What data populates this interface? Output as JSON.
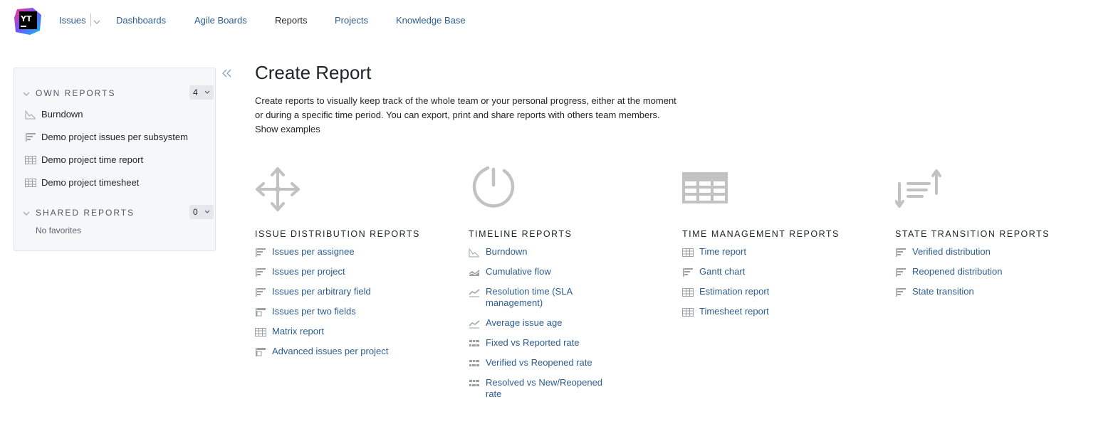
{
  "nav": {
    "logo_text": "YT",
    "items": [
      {
        "label": "Issues"
      },
      {
        "label": "Dashboards"
      },
      {
        "label": "Agile Boards"
      },
      {
        "label": "Reports"
      },
      {
        "label": "Projects"
      },
      {
        "label": "Knowledge Base"
      }
    ]
  },
  "sidebar": {
    "own": {
      "title": "OWN REPORTS",
      "count": "4",
      "items": [
        {
          "label": "Burndown",
          "icon": "burndown-icon"
        },
        {
          "label": "Demo project issues per subsystem",
          "icon": "distribution-icon"
        },
        {
          "label": "Demo project time report",
          "icon": "table-icon"
        },
        {
          "label": "Demo project timesheet",
          "icon": "table-icon"
        }
      ]
    },
    "shared": {
      "title": "SHARED REPORTS",
      "count": "0",
      "empty_text": "No favorites"
    }
  },
  "main": {
    "title": "Create Report",
    "intro": "Create reports to visually keep track of the whole team or your personal progress, either at the moment or during a specific time period. You can export, print and share reports with others team members.",
    "intro_link": "Show examples",
    "columns": [
      {
        "title": "ISSUE DISTRIBUTION REPORTS",
        "icon": "move-arrows-icon",
        "reports": [
          {
            "label": "Issues per assignee"
          },
          {
            "label": "Issues per project"
          },
          {
            "label": "Issues per arbitrary field"
          },
          {
            "label": "Issues per two fields"
          },
          {
            "label": "Matrix report"
          },
          {
            "label": "Advanced issues per project"
          }
        ]
      },
      {
        "title": "TIMELINE REPORTS",
        "icon": "timer-icon",
        "reports": [
          {
            "label": "Burndown"
          },
          {
            "label": "Cumulative flow"
          },
          {
            "label": "Resolution time (SLA management)"
          },
          {
            "label": "Average issue age"
          },
          {
            "label": "Fixed vs Reported rate"
          },
          {
            "label": "Verified vs Reopened rate"
          },
          {
            "label": "Resolved vs New/Reopened rate"
          }
        ]
      },
      {
        "title": "TIME MANAGEMENT REPORTS",
        "icon": "table-grid-icon",
        "reports": [
          {
            "label": "Time report"
          },
          {
            "label": "Gantt chart"
          },
          {
            "label": "Estimation report"
          },
          {
            "label": "Timesheet report"
          }
        ]
      },
      {
        "title": "STATE TRANSITION REPORTS",
        "icon": "sort-transition-icon",
        "reports": [
          {
            "label": "Verified distribution"
          },
          {
            "label": "Reopened distribution"
          },
          {
            "label": "State transition"
          }
        ]
      }
    ]
  }
}
